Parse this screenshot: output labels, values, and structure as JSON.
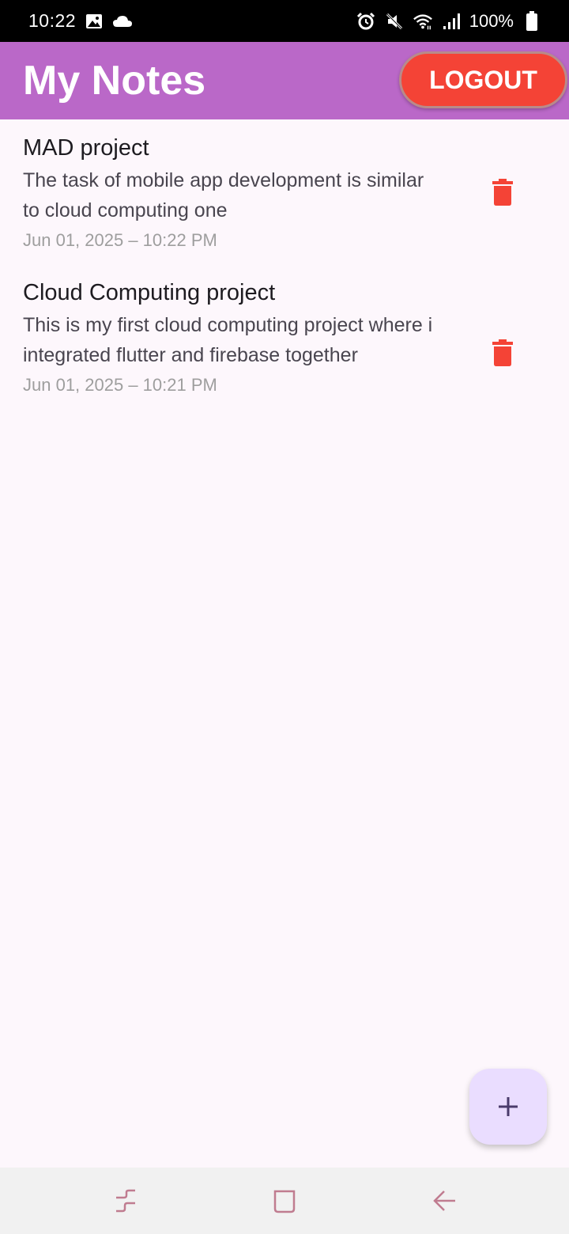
{
  "status_bar": {
    "time": "10:22",
    "battery": "100%",
    "icons": [
      "image-icon",
      "cloud-icon",
      "alarm-icon",
      "mute-icon",
      "wifi-icon",
      "signal-icon",
      "battery-icon"
    ]
  },
  "app_bar": {
    "title": "My Notes",
    "logout_label": "LOGOUT",
    "bg_color": "#ba68c8",
    "logout_color": "#f44336"
  },
  "notes": [
    {
      "title": "MAD project",
      "content": "The task of mobile app development is similar to cloud computing one",
      "date": "Jun 01, 2025 – 10:22 PM"
    },
    {
      "title": "Cloud Computing project",
      "content": "This is my first cloud computing project where i integrated flutter and firebase together",
      "date": "Jun 01, 2025 – 10:21 PM"
    }
  ],
  "fab": {
    "icon": "plus-icon",
    "color": "#eaddff"
  },
  "nav_bar": {
    "icons": [
      "recent-apps-icon",
      "home-icon",
      "back-icon"
    ]
  }
}
